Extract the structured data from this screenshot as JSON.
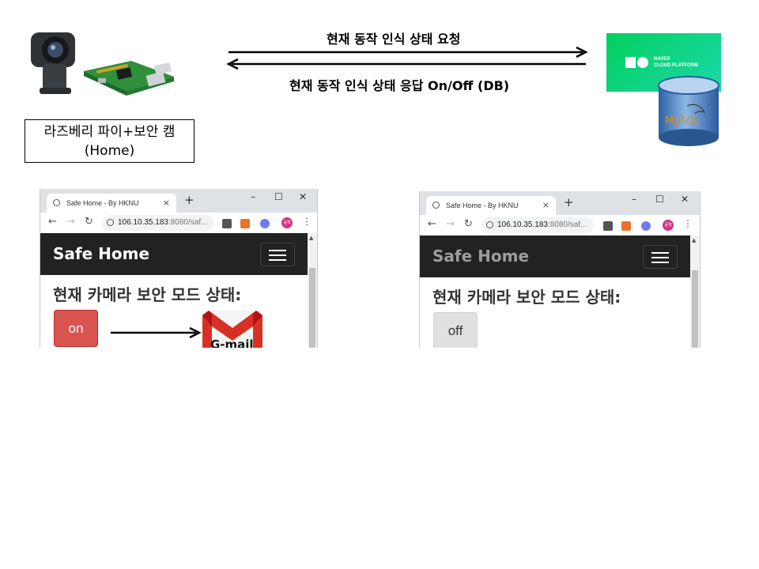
{
  "diagram": {
    "request_label": "현재 동작 인식 상태 요청",
    "response_label": "현재 동작 인식 상태 응답 On/Off (DB)",
    "device_label_line1": "라즈베리 파이+보안 캠",
    "device_label_line2": "(Home)",
    "cloud_brand": "NAVER",
    "cloud_sub": "CLOUD PLATFORM",
    "db_label": "MySQL"
  },
  "browser_common": {
    "tab_title": "Safe Home - By HKNU",
    "tab_close": "×",
    "new_tab": "+",
    "url_host": "106.10.35.183",
    "url_rest": ":8080/saf...",
    "win_minimize": "–",
    "win_maximize": "☐",
    "win_close": "✕",
    "nav_back": "←",
    "nav_forward": "→",
    "nav_reload": "↻",
    "menu_kebab": "⋮",
    "ext_profile": "공책",
    "brand": "Safe Home",
    "heading": "현재 카메라 보안 모드 상태:"
  },
  "browser_left": {
    "mode_button": "on",
    "brand_color": "#ffffff",
    "button_color": "#d9534f"
  },
  "browser_right": {
    "mode_button": "off",
    "brand_color": "#9d9d9d",
    "button_color": "#e0e0e0"
  },
  "notification": {
    "label": "G-mail",
    "icon": "gmail-icon"
  },
  "colors": {
    "navbar": "#222222",
    "naver_green": "#03cf5d",
    "arrow": "#000000"
  }
}
